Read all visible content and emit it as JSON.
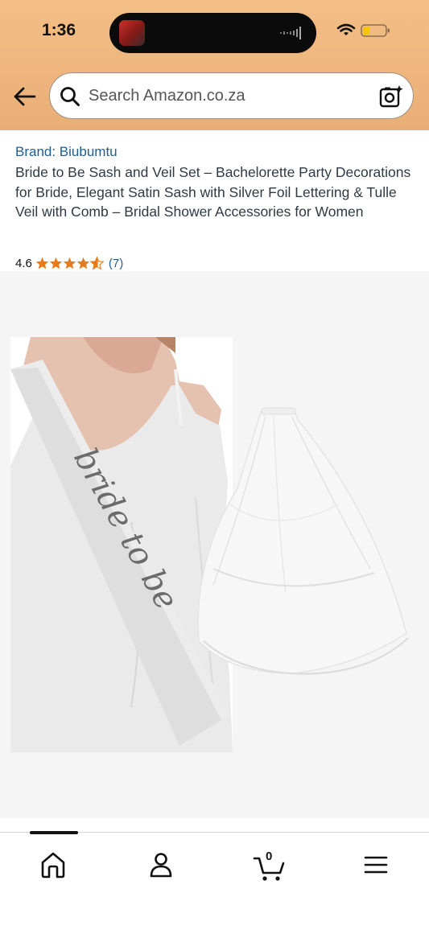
{
  "status_bar": {
    "time": "1:36"
  },
  "search": {
    "placeholder": "Search Amazon.co.za"
  },
  "product": {
    "brand": "Brand: Biubumtu",
    "title": "Bride to Be Sash and Veil Set – Bachelorette Party Decorations for Bride, Elegant Satin Sash with Silver Foil Lettering & Tulle Veil with Comb – Bridal Shower Accessories for Women",
    "rating": "4.6",
    "rating_stars": 4.6,
    "review_count": "(7)",
    "sash_text": "bride to be"
  },
  "bottom_nav": {
    "cart_count": "0",
    "items": [
      "home-icon",
      "account-icon",
      "cart-icon",
      "menu-icon"
    ]
  },
  "colors": {
    "header": "#eeb47e",
    "link": "#1f5d91",
    "star": "#e97a18"
  }
}
